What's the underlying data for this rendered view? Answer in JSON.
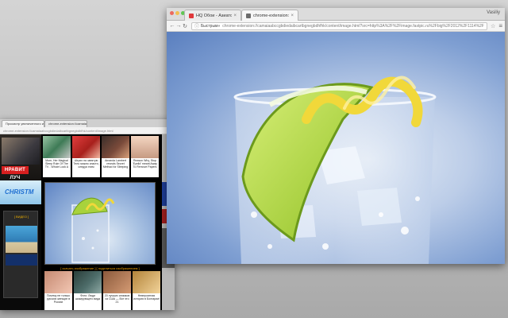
{
  "front_window": {
    "tabs": [
      {
        "label": "HQ Обои - Азиатская кухн",
        "active": false
      },
      {
        "label": "chrome-extension://camaiab",
        "active": true
      }
    ],
    "user": "Vasiliy",
    "toolbar": {
      "badge": "Быстрым»",
      "url": "chrome-extension://camaiaabccgbdiedaibcartbgnegbdhfhk/content/image.html?src=http%3A%2F%2Fimage.fastpic.ru%2Fbig%2F2012%2F1114%2Fb2%2F68bd58aeee..."
    },
    "image": {
      "description_name": "gin-tonic-glass-with-lime-and-lemon-peel",
      "bg_color": "#7f9fd2"
    }
  },
  "back_window": {
    "tabs": [
      {
        "label": "Просмотр увеличенного и",
        "active": true
      },
      {
        "label": "chrome-extension://camaiab",
        "active": false
      }
    ],
    "address": "chrome-extension://camaiaabccgbdiedaibcartbgnegbdhfhk/content/image.html",
    "left_col": {
      "badge": "НРАВИТ ЛУЧ",
      "banner": "CHRISTM",
      "box_label": "[ ВИДЕО ]"
    },
    "ads_row1": [
      {
        "text": "Mom, Her Magical Sleep Rule Of The TV - Whole Look A"
      },
      {
        "text": "Штрих на запятую Тело можно спасти, следуя этим"
      },
      {
        "text": "Amanda Lambert reveals Secret Method for Sleeping"
      },
      {
        "text": "Reason Why, Stop 'Eyelid' meant Away To Remove Papers"
      }
    ],
    "caption": "[ скачать изображение ] [ поделиться изображением ]",
    "ads_row2": [
      {
        "text": "Почему не только русских женщин в России"
      },
      {
        "text": "Фото: Люди шокирующего вида"
      },
      {
        "text": "20 лучших снимков из США — Вот это 21"
      },
      {
        "text": "Невероятная история в Болгарии!"
      }
    ]
  },
  "colors": {
    "desktop": "#bdbdbd",
    "lime": "#a8d23c",
    "lemon": "#f1d83a",
    "sky": "#5a7fbf",
    "ad_red": "#d71f1f",
    "caption": "#f0a000"
  }
}
